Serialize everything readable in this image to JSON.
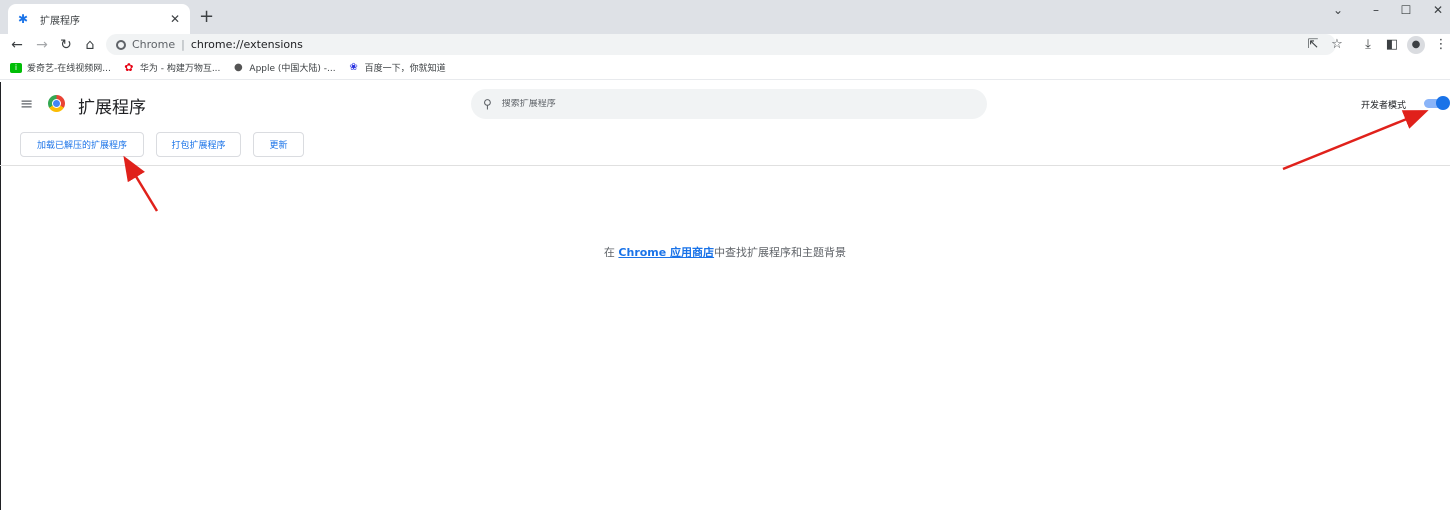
{
  "browser": {
    "tab": {
      "title": "扩展程序",
      "icon": "puzzle-icon"
    },
    "window_controls": [
      "chevron-down-icon",
      "minimize-icon",
      "maximize-icon",
      "close-icon"
    ],
    "omnibox": {
      "chip_label": "Chrome",
      "url": "chrome://extensions"
    },
    "bookmarks": [
      {
        "label": "爱奇艺-在线视频网...",
        "icon": "iqiyi-icon",
        "color": "#00be06"
      },
      {
        "label": "华为 - 构建万物互...",
        "icon": "huawei-icon",
        "color": "#e60012"
      },
      {
        "label": "Apple (中国大陆) -...",
        "icon": "apple-icon",
        "color": "#555555"
      },
      {
        "label": "百度一下，你就知道",
        "icon": "baidu-icon",
        "color": "#2932e1"
      }
    ]
  },
  "page": {
    "title": "扩展程序",
    "search_placeholder": "搜索扩展程序",
    "dev_mode": {
      "label": "开发者模式",
      "enabled": true
    },
    "buttons": {
      "load_unpacked": "加载已解压的扩展程序",
      "pack": "打包扩展程序",
      "update": "更新"
    },
    "empty_message": {
      "prefix": "在 ",
      "link": "Chrome 应用商店",
      "suffix": "中查找扩展程序和主题背景"
    }
  },
  "colors": {
    "accent": "#1a73e8",
    "annotation_arrow": "#e0211b"
  }
}
